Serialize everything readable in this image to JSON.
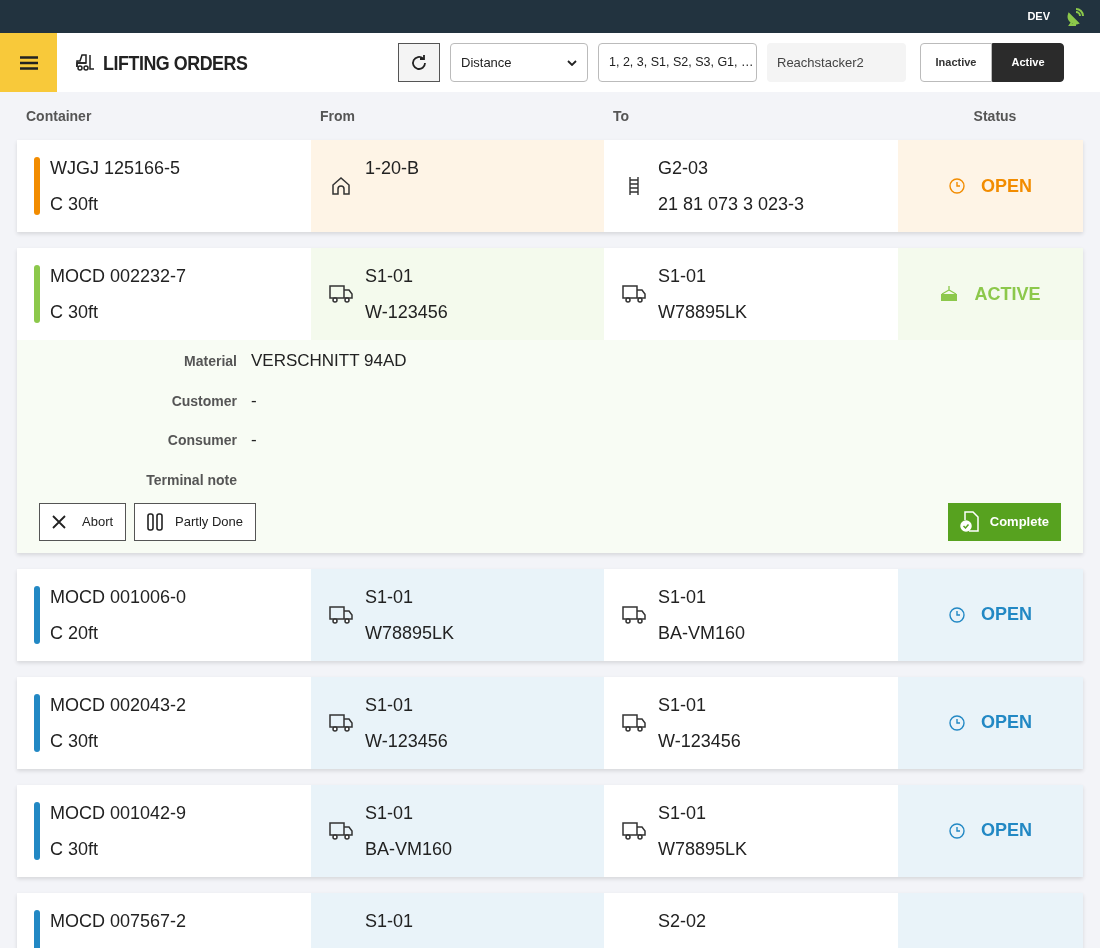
{
  "top_bar": {
    "env": "DEV"
  },
  "header": {
    "title": "LIFTING ORDERS",
    "sort": "Distance",
    "areas": "1, 2, 3, S1, S2, S3, G1, …",
    "machine": "Reachstacker2",
    "toggle": [
      {
        "label": "Inactive",
        "selected": false
      },
      {
        "label": "Active",
        "selected": true
      }
    ]
  },
  "columns": [
    "Container",
    "From",
    "To",
    "Status"
  ],
  "orders": [
    {
      "container": "WJGJ 125166-5",
      "size": "C 30ft",
      "color": "#f28c00",
      "from": {
        "kind": "yard",
        "lines": [
          "1-20-B"
        ]
      },
      "to": {
        "kind": "rail",
        "lines": [
          "G2-03",
          "21 81 073 3 023-3"
        ]
      },
      "status": {
        "kind": "open",
        "label": "OPEN"
      }
    },
    {
      "container": "MOCD 002232-7",
      "size": "C 30ft",
      "color": "#8cc84b",
      "from": {
        "kind": "truck",
        "lines": [
          "S1-01",
          "W-123456"
        ]
      },
      "to": {
        "kind": "truck",
        "lines": [
          "S1-01",
          "W78895LK"
        ]
      },
      "status": {
        "kind": "active",
        "label": "ACTIVE"
      },
      "details": {
        "fields": [
          {
            "label": "Material",
            "value": "VERSCHNITT 94AD"
          },
          {
            "label": "Customer",
            "value": "-"
          },
          {
            "label": "Consumer",
            "value": "-"
          },
          {
            "label": "Terminal note"
          }
        ],
        "actions": [
          {
            "kind": "abort",
            "label": "Abort"
          },
          {
            "kind": "partly",
            "label": "Partly Done"
          },
          {
            "kind": "complete",
            "label": "Complete"
          }
        ]
      }
    },
    {
      "container": "MOCD 001006-0",
      "size": "C 20ft",
      "color": "#2288c4",
      "from": {
        "kind": "truck",
        "lines": [
          "S1-01",
          "W78895LK"
        ]
      },
      "to": {
        "kind": "truck",
        "lines": [
          "S1-01",
          "BA-VM160"
        ]
      },
      "status": {
        "kind": "open",
        "label": "OPEN"
      }
    },
    {
      "container": "MOCD 002043-2",
      "size": "C 30ft",
      "color": "#2288c4",
      "from": {
        "kind": "truck",
        "lines": [
          "S1-01",
          "W-123456"
        ]
      },
      "to": {
        "kind": "truck",
        "lines": [
          "S1-01",
          "W-123456"
        ]
      },
      "status": {
        "kind": "open",
        "label": "OPEN"
      }
    },
    {
      "container": "MOCD 001042-9",
      "size": "C 30ft",
      "color": "#2288c4",
      "from": {
        "kind": "truck",
        "lines": [
          "S1-01",
          "BA-VM160"
        ]
      },
      "to": {
        "kind": "truck",
        "lines": [
          "S1-01",
          "W78895LK"
        ]
      },
      "status": {
        "kind": "open",
        "label": "OPEN"
      }
    },
    {
      "container": "MOCD 007567-2",
      "color": "#2288c4",
      "from": {
        "lines": [
          "S1-01"
        ]
      },
      "to": {
        "lines": [
          "S2-02"
        ]
      }
    }
  ]
}
